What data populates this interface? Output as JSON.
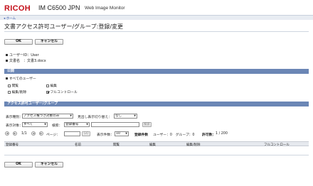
{
  "header": {
    "logo": "RICOH",
    "model": "IM C6500 JPN",
    "product": "Web Image Monitor"
  },
  "nav": {
    "home": "◂ ホーム"
  },
  "page": {
    "title": "文書アクセス許可ユーザー/グループ:登録/変更"
  },
  "buttons": {
    "ok": "OK",
    "cancel": "キャンセル"
  },
  "info": {
    "user_id": "ユーザーID：User",
    "document_name": "文書名　：文書3.docx"
  },
  "public_section": {
    "heading": "公開",
    "all_users": "すべてのユーザー",
    "perms": [
      {
        "label": "閲覧",
        "checked": false
      },
      {
        "label": "編集",
        "checked": false
      },
      {
        "label": "編集/削除",
        "checked": false
      },
      {
        "label": "フルコントロール",
        "checked": true
      }
    ]
  },
  "access_section": {
    "heading": "アクセス許可ユーザー/グループ",
    "display_type_label": "表示種別：",
    "display_type_value": "アクセス権つき対象のみ",
    "heading_switch_label": "見出し表示切り替え：",
    "heading_switch_value": "なし",
    "display_target_label": "表示対象：",
    "display_target_value": "すべて",
    "search_label": "検索：",
    "search_field_value": "登録番号",
    "search_input_value": "",
    "search_button": "検索",
    "page_indicator": "1/1",
    "page_label": "ページ：",
    "page_input_value": "",
    "go_button": "GO",
    "per_page_label": "表示件数：",
    "per_page_value": "10",
    "count_summary_label": "登録件数",
    "count_summary": "ユーザー：0　グループ：0",
    "permitted_label": "許可数：",
    "permitted_value": "1 / 200"
  },
  "table": {
    "columns": [
      "登録番号",
      "名前",
      "閲覧",
      "編集",
      "編集/削除",
      "フルコントロール"
    ]
  }
}
